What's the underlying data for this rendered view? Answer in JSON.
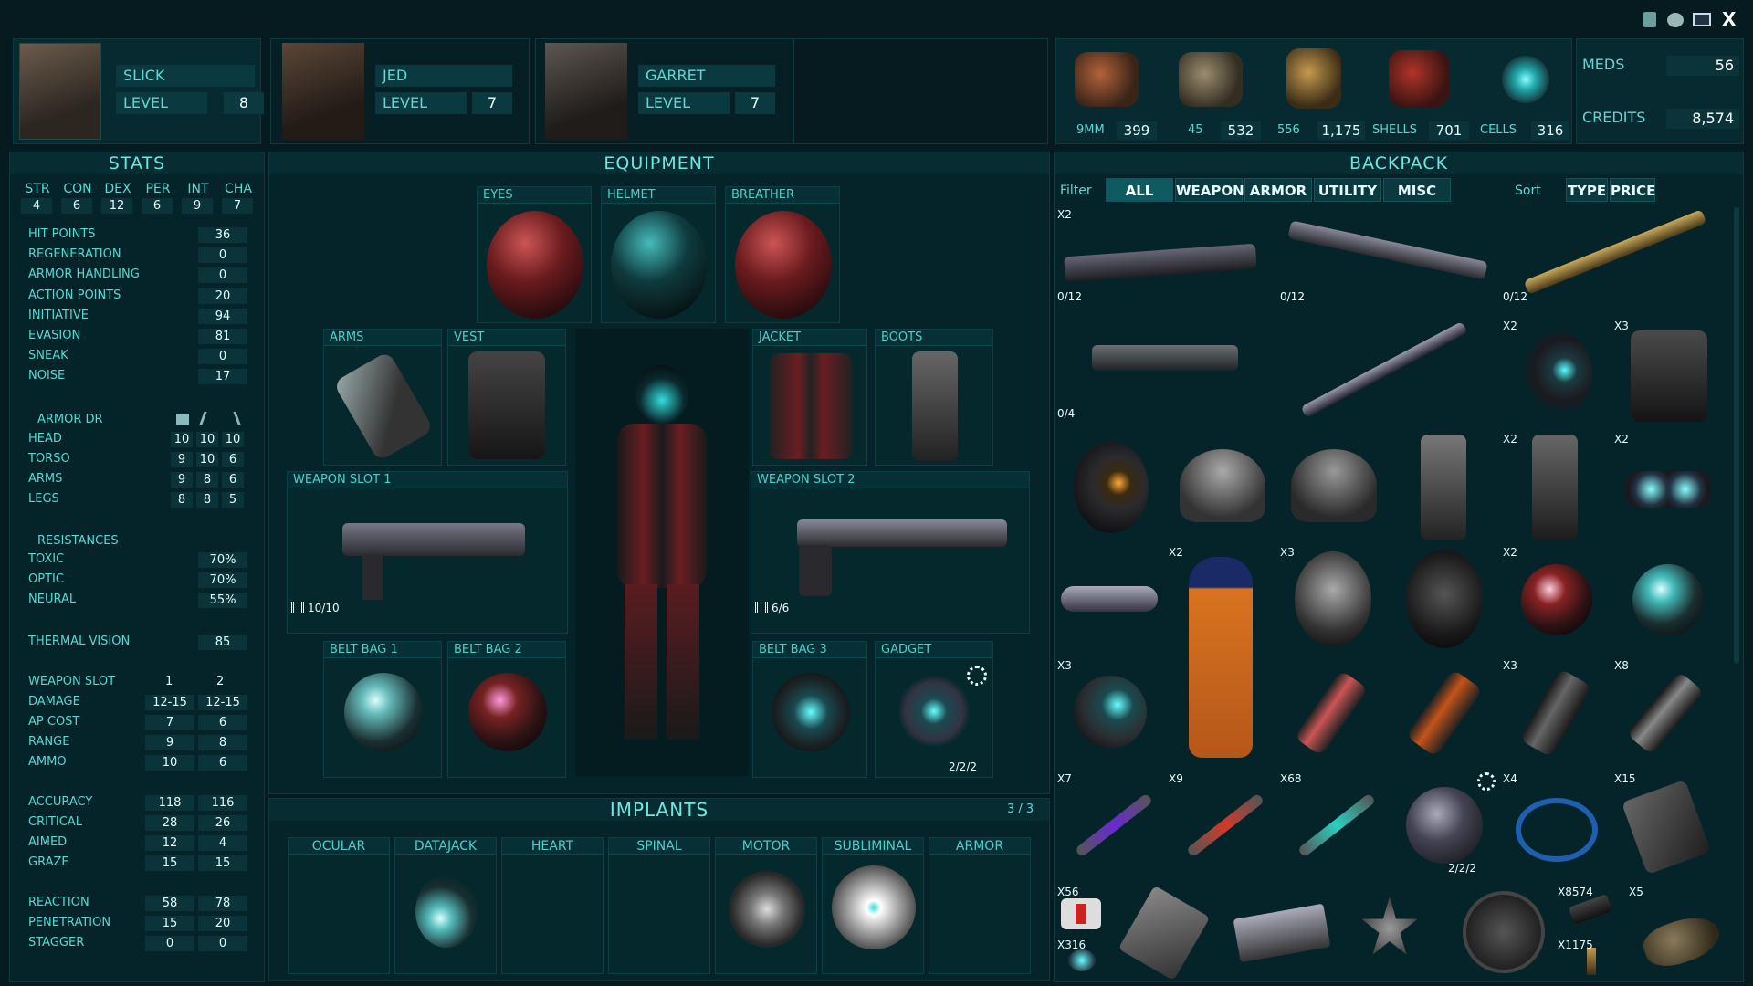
{
  "window": {
    "controls": [
      "clipboard-icon",
      "cloud-icon",
      "monitor-icon",
      "close-icon"
    ],
    "close_label": "X"
  },
  "party": [
    {
      "name": "SLICK",
      "level_label": "LEVEL",
      "level": "8"
    },
    {
      "name": "JED",
      "level_label": "LEVEL",
      "level": "7"
    },
    {
      "name": "GARRET",
      "level_label": "LEVEL",
      "level": "7"
    }
  ],
  "ammo": [
    {
      "label": "9MM",
      "value": "399"
    },
    {
      "label": "45",
      "value": "532"
    },
    {
      "label": "556",
      "value": "1,175"
    },
    {
      "label": "SHELLS",
      "value": "701"
    },
    {
      "label": "CELLS",
      "value": "316"
    }
  ],
  "resources": {
    "meds_label": "MEDS",
    "meds": "56",
    "credits_label": "CREDITS",
    "credits": "8,574"
  },
  "stats": {
    "title": "STATS",
    "attributes": [
      {
        "k": "STR",
        "v": "4"
      },
      {
        "k": "CON",
        "v": "6"
      },
      {
        "k": "DEX",
        "v": "12"
      },
      {
        "k": "PER",
        "v": "6"
      },
      {
        "k": "INT",
        "v": "9"
      },
      {
        "k": "CHA",
        "v": "7"
      }
    ],
    "core": [
      {
        "k": "HIT POINTS",
        "v": "36"
      },
      {
        "k": "REGENERATION",
        "v": "0"
      },
      {
        "k": "ARMOR HANDLING",
        "v": "0"
      },
      {
        "k": "ACTION POINTS",
        "v": "20"
      },
      {
        "k": "INITIATIVE",
        "v": "94"
      },
      {
        "k": "EVASION",
        "v": "81"
      },
      {
        "k": "SNEAK",
        "v": "0"
      },
      {
        "k": "NOISE",
        "v": "17"
      }
    ],
    "armor_dr_label": "ARMOR DR",
    "armor_dr": [
      {
        "k": "HEAD",
        "v": [
          "10",
          "10",
          "10"
        ]
      },
      {
        "k": "TORSO",
        "v": [
          "9",
          "10",
          "6"
        ]
      },
      {
        "k": "ARMS",
        "v": [
          "9",
          "8",
          "6"
        ]
      },
      {
        "k": "LEGS",
        "v": [
          "8",
          "8",
          "5"
        ]
      }
    ],
    "resistances_label": "RESISTANCES",
    "resistances": [
      {
        "k": "TOXIC",
        "v": "70%"
      },
      {
        "k": "OPTIC",
        "v": "70%"
      },
      {
        "k": "NEURAL",
        "v": "55%"
      }
    ],
    "thermal": {
      "k": "THERMAL VISION",
      "v": "85"
    },
    "weapon_slot_label": "WEAPON SLOT",
    "slot_1": "1",
    "slot_2": "2",
    "weapon": [
      {
        "k": "DAMAGE",
        "v": [
          "12-15",
          "12-15"
        ]
      },
      {
        "k": "AP COST",
        "v": [
          "7",
          "6"
        ]
      },
      {
        "k": "RANGE",
        "v": [
          "9",
          "8"
        ]
      },
      {
        "k": "AMMO",
        "v": [
          "10",
          "6"
        ]
      }
    ],
    "combat": [
      {
        "k": "ACCURACY",
        "v": [
          "118",
          "116"
        ]
      },
      {
        "k": "CRITICAL",
        "v": [
          "28",
          "26"
        ]
      },
      {
        "k": "AIMED",
        "v": [
          "12",
          "4"
        ]
      },
      {
        "k": "GRAZE",
        "v": [
          "15",
          "15"
        ]
      }
    ],
    "reaction": [
      {
        "k": "REACTION",
        "v": [
          "58",
          "78"
        ]
      },
      {
        "k": "PENETRATION",
        "v": [
          "15",
          "20"
        ]
      },
      {
        "k": "STAGGER",
        "v": [
          "0",
          "0"
        ]
      }
    ]
  },
  "equipment": {
    "title": "EQUIPMENT",
    "eyes": "EYES",
    "helmet": "HELMET",
    "breather": "BREATHER",
    "arms": "ARMS",
    "vest": "VEST",
    "jacket": "JACKET",
    "boots": "BOOTS",
    "weapon1": "WEAPON SLOT 1",
    "weapon1_ammo": "10/10",
    "weapon2": "WEAPON SLOT 2",
    "weapon2_ammo": "6/6",
    "belt1": "BELT BAG 1",
    "belt2": "BELT BAG 2",
    "belt3": "BELT BAG 3",
    "gadget": "GADGET",
    "gadget_charges": "2/2/2"
  },
  "implants": {
    "title": "IMPLANTS",
    "count": "3 / 3",
    "slots": [
      "OCULAR",
      "DATAJACK",
      "HEART",
      "SPINAL",
      "MOTOR",
      "SUBLIMINAL",
      "ARMOR"
    ]
  },
  "backpack": {
    "title": "BACKPACK",
    "filter_label": "Filter",
    "filters": [
      "ALL",
      "WEAPON",
      "ARMOR",
      "UTILITY",
      "MISC"
    ],
    "sort_label": "Sort",
    "sorts": [
      "TYPE",
      "PRICE"
    ],
    "labels": {
      "r1a": "X2",
      "r1a_ammo": "0/12",
      "r1b_ammo": "0/12",
      "r1c_ammo": "0/12",
      "r2a_ammo": "0/4",
      "r2c": "X2",
      "r2d": "X3",
      "r3d": "X2",
      "r3e": "X2",
      "r4b": "X2",
      "r4c": "X3",
      "r4e": "X2",
      "r5a": "X3",
      "r5e": "X3",
      "r5f": "X8",
      "r6a": "X7",
      "r6b": "X9",
      "r6c": "X68",
      "r6d_charges": "2/2/2",
      "r6e": "X4",
      "r6f": "X15",
      "r7a": "X56",
      "r7a2": "X316",
      "r7f": "X8574",
      "r7f2": "X1175",
      "r7g": "X5"
    }
  },
  "colors": {
    "accent": "#5fd7d2",
    "panel": "#06262b",
    "value_bg": "#0a343a",
    "bright": "#e7fbfa"
  }
}
